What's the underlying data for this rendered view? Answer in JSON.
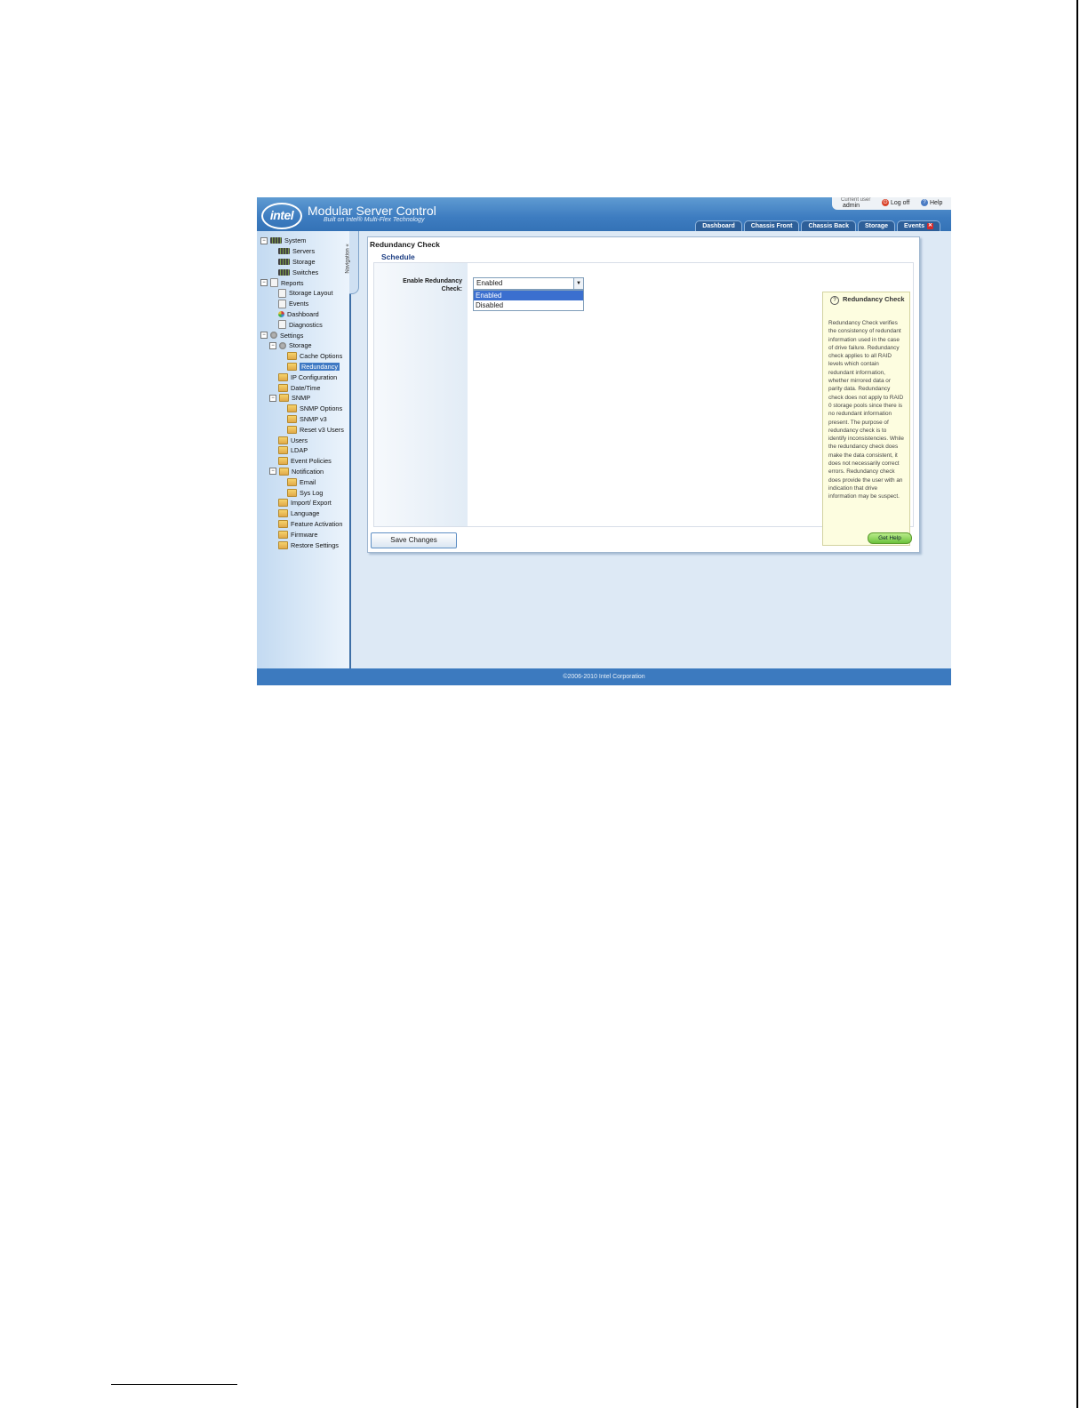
{
  "header": {
    "logo": "intel",
    "title": "Modular Server Control",
    "subtitle": "Built on Intel® Multi-Flex Technology",
    "current_user_label": "Current user",
    "current_user": "admin",
    "logoff_label": "Log off",
    "help_label": "Help",
    "tabs": [
      {
        "label": "Dashboard"
      },
      {
        "label": "Chassis Front"
      },
      {
        "label": "Chassis Back"
      },
      {
        "label": "Storage"
      },
      {
        "label": "Events"
      }
    ]
  },
  "nav": {
    "collapse_label": "Navigation «",
    "items": [
      {
        "label": "System"
      },
      {
        "label": "Servers"
      },
      {
        "label": "Storage"
      },
      {
        "label": "Switches"
      },
      {
        "label": "Reports"
      },
      {
        "label": "Storage Layout"
      },
      {
        "label": "Events"
      },
      {
        "label": "Dashboard"
      },
      {
        "label": "Diagnostics"
      },
      {
        "label": "Settings"
      },
      {
        "label": "Storage"
      },
      {
        "label": "Cache Options"
      },
      {
        "label": "Redundancy"
      },
      {
        "label": "IP Configuration"
      },
      {
        "label": "Date/Time"
      },
      {
        "label": "SNMP"
      },
      {
        "label": "SNMP Options"
      },
      {
        "label": "SNMP v3"
      },
      {
        "label": "Reset v3 Users"
      },
      {
        "label": "Users"
      },
      {
        "label": "LDAP"
      },
      {
        "label": "Event Policies"
      },
      {
        "label": "Notification"
      },
      {
        "label": "Email"
      },
      {
        "label": "Sys Log"
      },
      {
        "label": "Import/ Export"
      },
      {
        "label": "Language"
      },
      {
        "label": "Feature Activation"
      },
      {
        "label": "Firmware"
      },
      {
        "label": "Restore Settings"
      }
    ]
  },
  "main": {
    "title": "Redundancy Check",
    "section": "Schedule",
    "field_label": "Enable Redundancy Check:",
    "select_value": "Enabled",
    "options": [
      "Enabled",
      "Disabled"
    ],
    "help_title": "Redundancy Check",
    "help_text": "Redundancy Check verifies the consistency of redundant information used in the case of drive failure. Redundancy check applies to all RAID levels which contain redundant information, whether mirrored data or parity data. Redundancy check does not apply to RAID 0 storage pools since there is no redundant information present. The purpose of redundancy check is to identify inconsistencies. While the redundancy check does make the data consistent, it does not necessarily correct errors. Redundancy check does provide the user with an indication that drive information may be suspect.",
    "save_label": "Save Changes",
    "get_help_label": "Get Help"
  },
  "footer": {
    "copyright": "©2006-2010 Intel Corporation"
  }
}
